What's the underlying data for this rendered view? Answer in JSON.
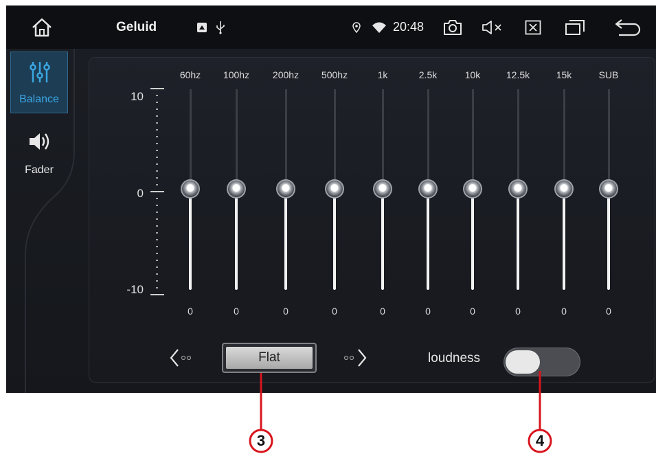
{
  "status_bar": {
    "title": "Geluid",
    "time": "20:48",
    "icons": [
      "home-icon",
      "notification-icon",
      "usb-icon",
      "location-icon",
      "wifi-icon",
      "screenshot-icon",
      "mute-icon",
      "close-app-icon",
      "recent-apps-icon",
      "back-icon"
    ]
  },
  "sidebar": {
    "tabs": [
      {
        "label": "Balance",
        "icon": "equalizer-icon",
        "active": true
      },
      {
        "label": "Fader",
        "icon": "speaker-icon",
        "active": false
      }
    ]
  },
  "equalizer": {
    "scale": {
      "top": "10",
      "middle": "0",
      "bottom": "-10"
    },
    "bands": [
      {
        "freq": "60hz",
        "value": "0"
      },
      {
        "freq": "100hz",
        "value": "0"
      },
      {
        "freq": "200hz",
        "value": "0"
      },
      {
        "freq": "500hz",
        "value": "0"
      },
      {
        "freq": "1k",
        "value": "0"
      },
      {
        "freq": "2.5k",
        "value": "0"
      },
      {
        "freq": "10k",
        "value": "0"
      },
      {
        "freq": "12.5k",
        "value": "0"
      },
      {
        "freq": "15k",
        "value": "0"
      },
      {
        "freq": "SUB",
        "value": "0"
      }
    ]
  },
  "controls": {
    "preset_label": "Flat",
    "loudness_label": "loudness",
    "loudness_on": false
  },
  "callouts": [
    "3",
    "4"
  ],
  "colors": {
    "accent": "#3aa6e0",
    "callout": "#d8141c"
  }
}
